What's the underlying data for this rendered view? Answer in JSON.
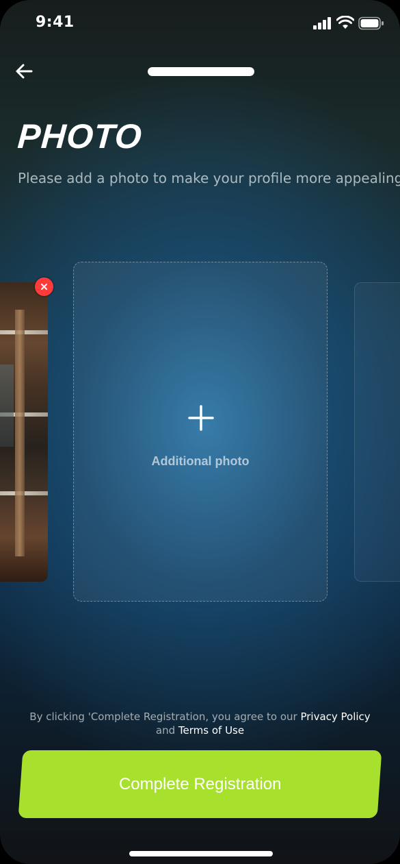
{
  "status_bar": {
    "time": "9:41",
    "signal_icon": "cellular-signal-icon",
    "wifi_icon": "wifi-icon",
    "battery_icon": "battery-icon"
  },
  "header": {
    "back_icon": "arrow-left-icon",
    "progress": 1.0
  },
  "title": "PHOTO",
  "subtitle": "Please add a photo to make your profile more appealing",
  "photos": {
    "remove_icon": "close-icon",
    "add_slot": {
      "icon": "plus-icon",
      "label": "Additional photo"
    }
  },
  "footer": {
    "terms_prefix": "By clicking 'Complete Registration, you agree to our",
    "privacy_link": "Privacy Policy",
    "terms_and": "and",
    "terms_link": "Terms of Use",
    "cta_label": "Complete Registration"
  },
  "colors": {
    "accent": "#a8e02e",
    "remove_badge": "#ff3b3b"
  }
}
